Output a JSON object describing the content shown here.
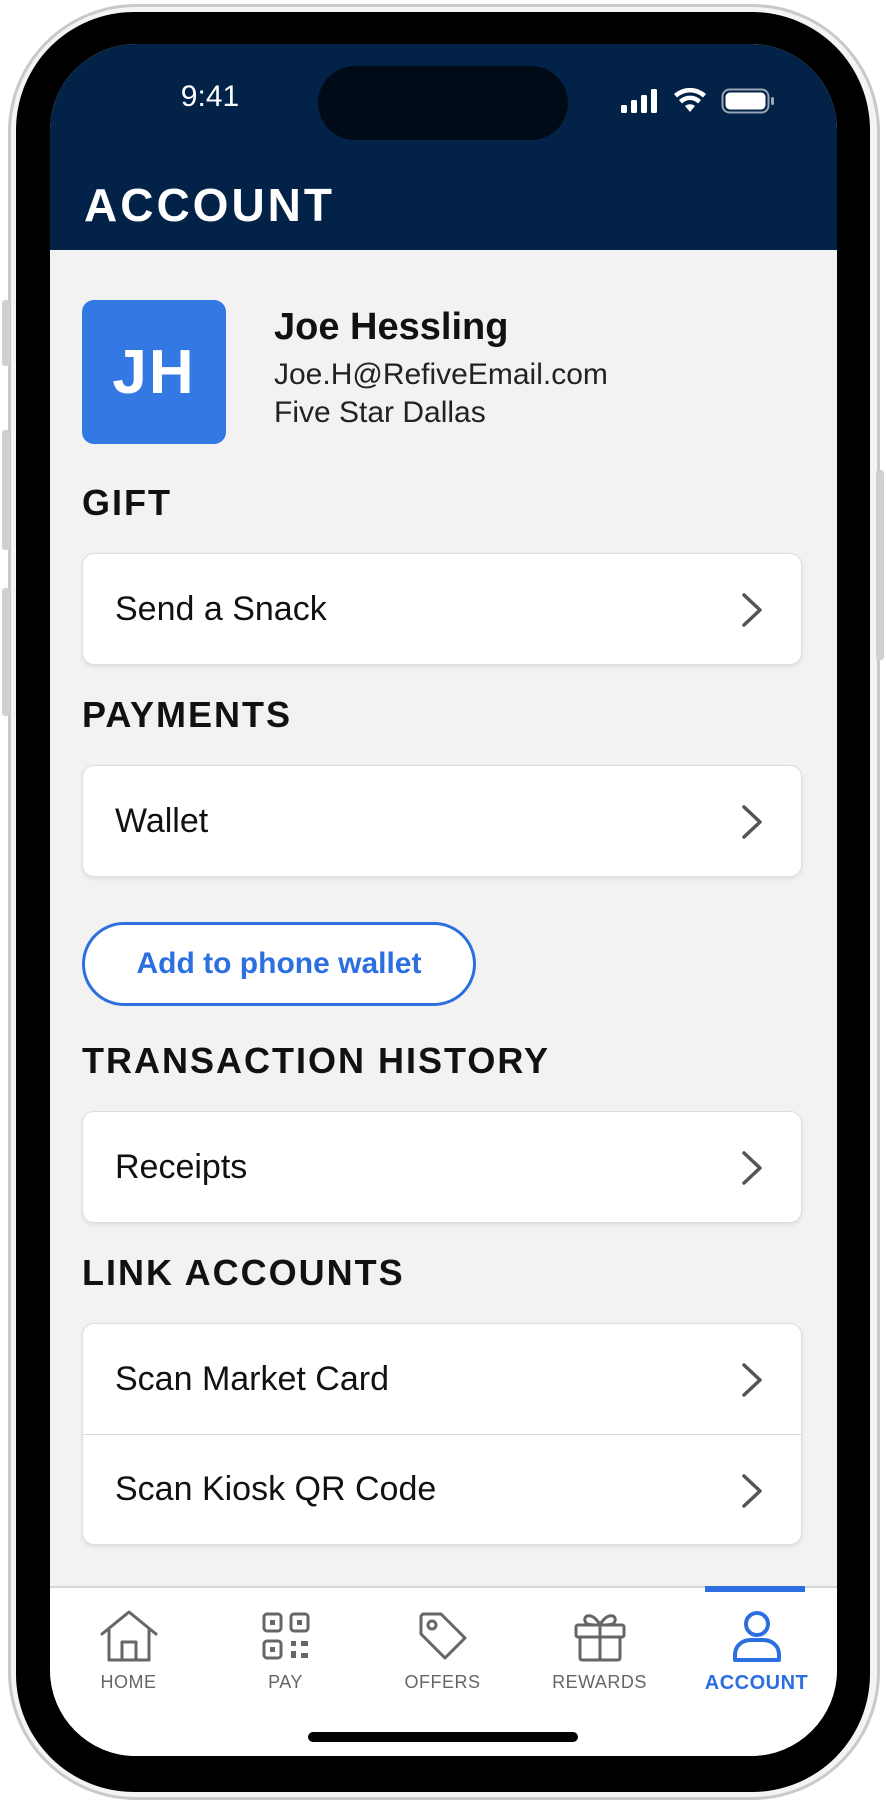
{
  "status_bar": {
    "time": "9:41"
  },
  "header": {
    "title": "ACCOUNT"
  },
  "profile": {
    "initials": "JH",
    "name": "Joe Hessling",
    "email": "Joe.H@RefiveEmail.com",
    "location": "Five Star Dallas"
  },
  "sections": {
    "gift": {
      "title": "GIFT",
      "items": [
        {
          "label": "Send a Snack"
        }
      ]
    },
    "payments": {
      "title": "PAYMENTS",
      "items": [
        {
          "label": "Wallet"
        }
      ],
      "button_label": "Add to phone wallet"
    },
    "transaction_history": {
      "title": "TRANSACTION HISTORY",
      "items": [
        {
          "label": "Receipts"
        }
      ]
    },
    "link_accounts": {
      "title": "LINK ACCOUNTS",
      "items": [
        {
          "label": "Scan Market Card"
        },
        {
          "label": "Scan Kiosk QR Code"
        }
      ]
    }
  },
  "tabbar": {
    "tabs": [
      {
        "label": "HOME",
        "icon": "home-icon"
      },
      {
        "label": "PAY",
        "icon": "qr-code-icon"
      },
      {
        "label": "OFFERS",
        "icon": "tag-icon"
      },
      {
        "label": "REWARDS",
        "icon": "gift-icon"
      },
      {
        "label": "ACCOUNT",
        "icon": "user-icon",
        "active": true
      }
    ]
  },
  "colors": {
    "header_bg": "#032247",
    "accent": "#2c6fe0",
    "avatar_bg": "#3478e4",
    "screen_bg": "#f2f2f2"
  }
}
